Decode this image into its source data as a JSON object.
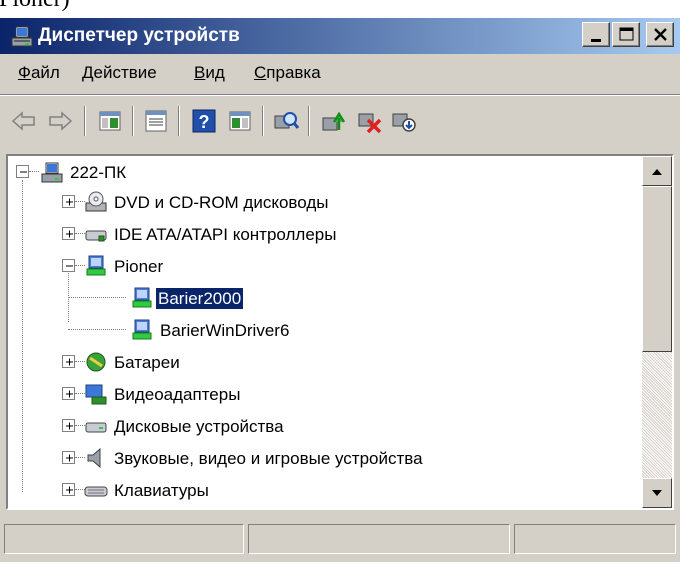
{
  "clipped_text": "Pioner)",
  "window": {
    "title": "Диспетчер устройств",
    "controls": {
      "minimize": "minimize",
      "maximize": "maximize",
      "close": "close"
    }
  },
  "menu": [
    {
      "accel": "Ф",
      "rest": "айл"
    },
    {
      "accel": "Д",
      "rest": "ействие"
    },
    {
      "accel": "В",
      "rest": "ид"
    },
    {
      "accel": "С",
      "rest": "правка"
    }
  ],
  "toolbar": [
    "back-arrow-icon",
    "forward-arrow-icon",
    "show-hide-console-tree-icon",
    "properties-icon",
    "help-icon",
    "action-pane-icon",
    "scan-hardware-icon",
    "update-driver-icon",
    "uninstall-icon",
    "disable-device-icon"
  ],
  "tree": {
    "root": "222-ПК",
    "items": [
      {
        "label": "DVD и CD-ROM дисководы",
        "expanded": false
      },
      {
        "label": "IDE ATA/ATAPI контроллеры",
        "expanded": false
      },
      {
        "label": "Pioner",
        "expanded": true,
        "children": [
          {
            "label": "Barier2000",
            "selected": true
          },
          {
            "label": "BarierWinDriver6",
            "selected": false
          }
        ]
      },
      {
        "label": "Батареи",
        "expanded": false
      },
      {
        "label": "Видеоадаптеры",
        "expanded": false
      },
      {
        "label": "Дисковые устройства",
        "expanded": false
      },
      {
        "label": "Звуковые, видео и игровые устройства",
        "expanded": false
      },
      {
        "label": "Клавиатуры",
        "expanded": false
      }
    ]
  },
  "statusbar": {
    "panels": [
      "",
      "",
      ""
    ]
  },
  "colors": {
    "title_start": "#0a246a",
    "title_end": "#a6caf0",
    "chrome": "#d4d0c8",
    "selection": "#0a246a"
  }
}
